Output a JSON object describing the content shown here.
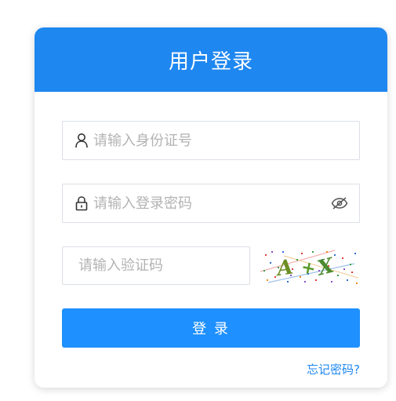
{
  "title": "用户登录",
  "fields": {
    "id_number": {
      "placeholder": "请输入身份证号",
      "value": "",
      "icon": "user-icon"
    },
    "password": {
      "placeholder": "请输入登录密码",
      "value": "",
      "icon": "lock-icon",
      "toggle_icon": "eye-off-icon"
    },
    "captcha": {
      "placeholder": "请输入验证码",
      "value": "",
      "image_text": "A+X"
    }
  },
  "login_button_label": "登 录",
  "forgot_password_label": "忘记密码?",
  "colors": {
    "header": "#1e87f0",
    "button": "#1e90ff",
    "link": "#1e87f0"
  }
}
